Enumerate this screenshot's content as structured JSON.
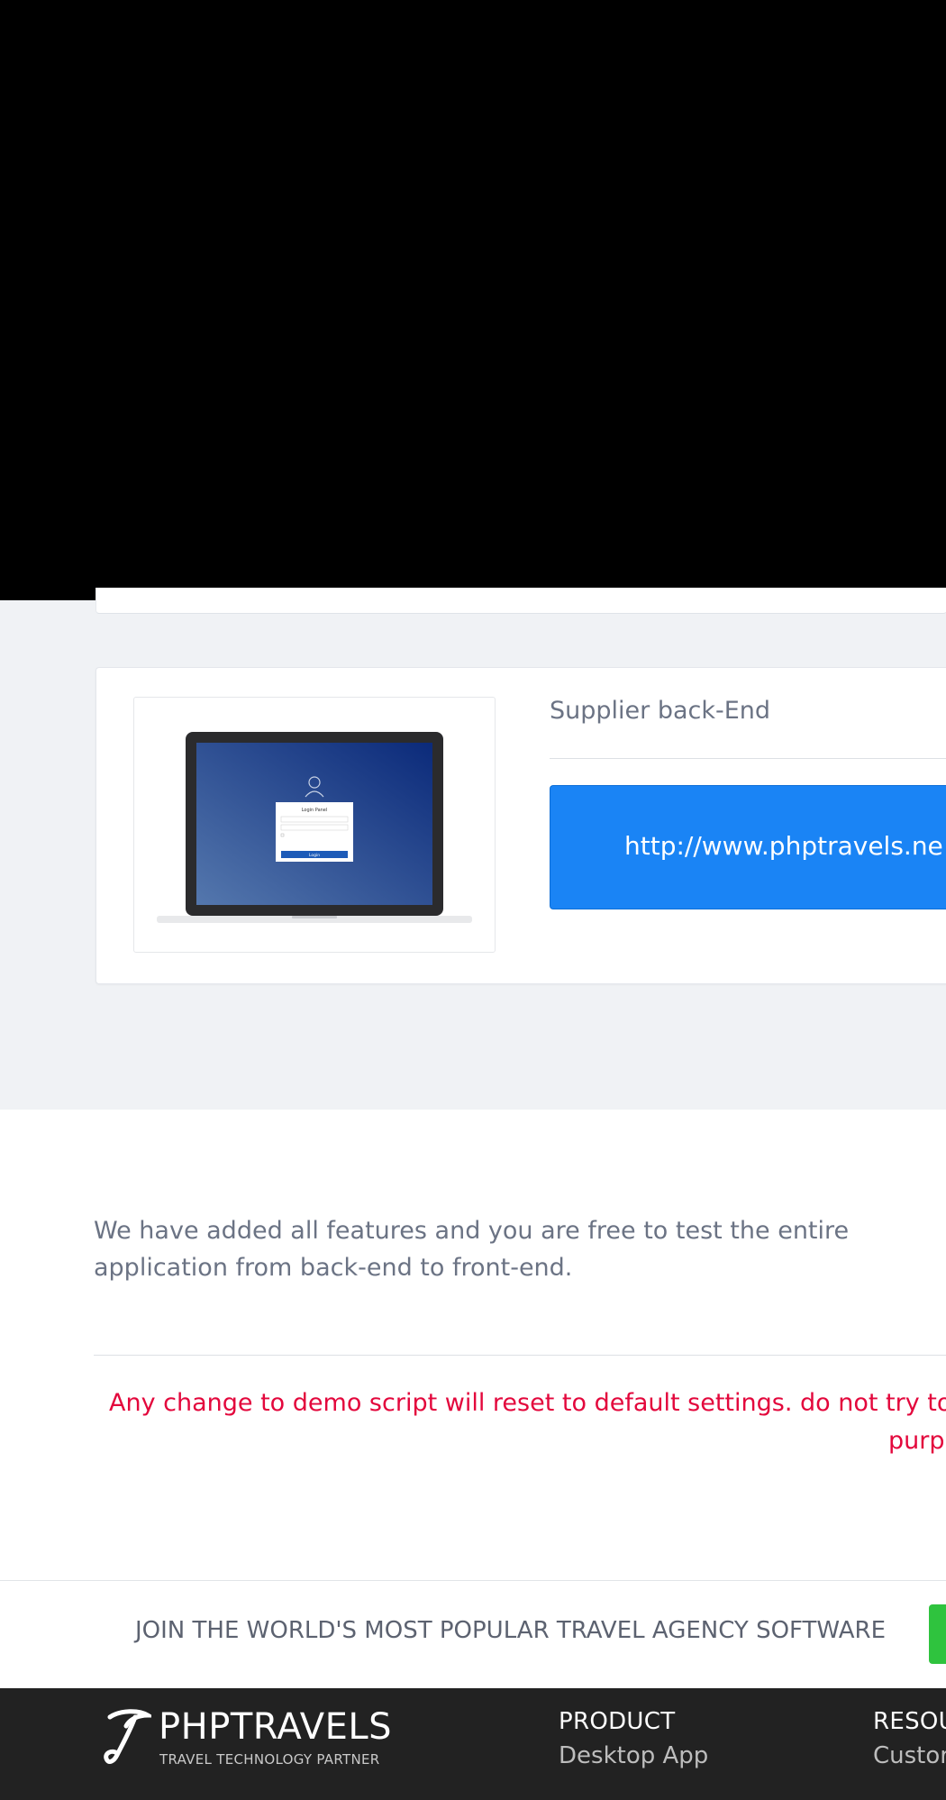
{
  "card": {
    "title": "Supplier back-End",
    "url": "http://www.phptravels.ne",
    "thumbnail": {
      "panel_title": "Login Panel",
      "login_button": "Login"
    }
  },
  "info": {
    "features_text": "We have added all features and you are free to test the entire application from back-end to front-end.",
    "warning_line1": "Any change to demo script will reset to default settings. do not try to ed",
    "warning_line2": "purp"
  },
  "join": {
    "text": "JOIN THE WORLD'S MOST POPULAR TRAVEL AGENCY SOFTWARE"
  },
  "footer": {
    "brand": {
      "name": "PHPTRAVELS",
      "tagline": "TRAVEL TECHNOLOGY PARTNER"
    },
    "columns": [
      {
        "heading": "PRODUCT",
        "first_link": "Desktop App"
      },
      {
        "heading": "RESOU",
        "first_link": "Custor"
      }
    ]
  },
  "colors": {
    "accent_blue": "#1a84f5",
    "warning_red": "#e3073c",
    "cta_green": "#2fc33e",
    "footer_bg": "#222222",
    "section_bg": "#f0f2f5"
  }
}
